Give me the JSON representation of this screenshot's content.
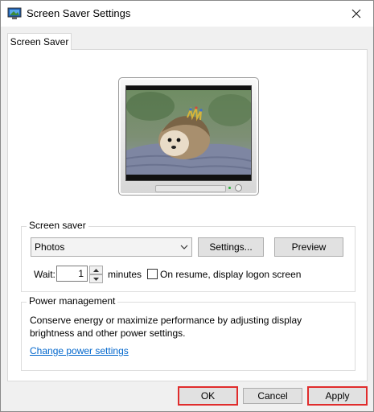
{
  "window": {
    "title": "Screen Saver Settings"
  },
  "tabs": [
    {
      "label": "Screen Saver"
    }
  ],
  "screen_saver": {
    "legend": "Screen saver",
    "selected": "Photos",
    "settings_label": "Settings...",
    "preview_label": "Preview",
    "wait_label": "Wait:",
    "wait_value": "1",
    "minutes_label": "minutes",
    "resume_label": "On resume, display logon screen",
    "resume_checked": false
  },
  "power": {
    "legend": "Power management",
    "description": "Conserve energy or maximize performance by adjusting display brightness and other power settings.",
    "link": "Change power settings"
  },
  "buttons": {
    "ok": "OK",
    "cancel": "Cancel",
    "apply": "Apply"
  },
  "colors": {
    "highlight": "#e02c2c",
    "link": "#0066cc"
  }
}
